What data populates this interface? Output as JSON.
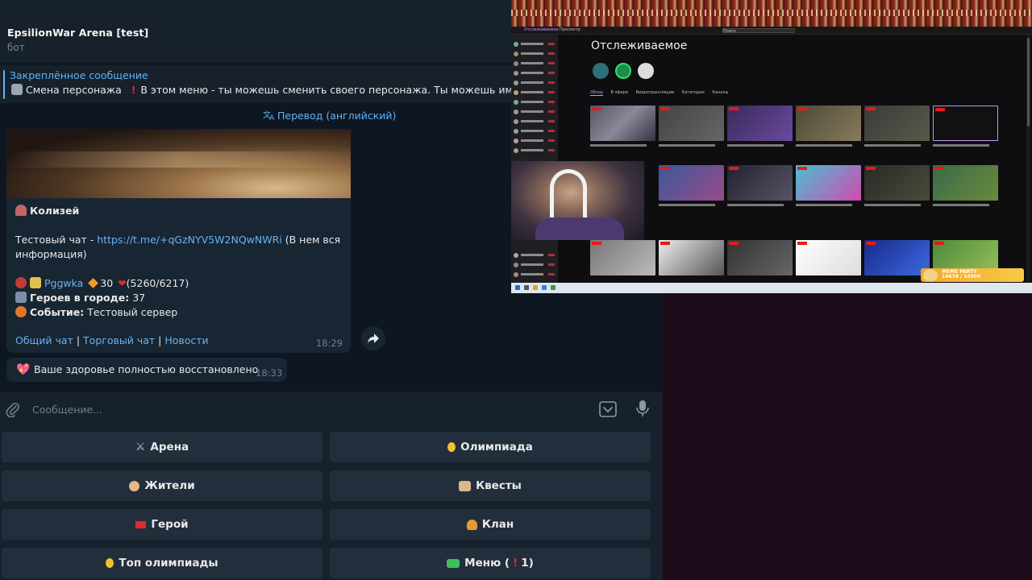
{
  "chat": {
    "title": "EpsilionWar Arena [test]",
    "subtitle": "бот"
  },
  "pinned": {
    "title": "Закреплённое сообщение",
    "text_a": "Смена персонажа",
    "text_b": "В этом меню - ты можешь сменить своего персонажа. Ты можешь иметь"
  },
  "translate_label": "Перевод (английский)",
  "message": {
    "location": "Колизей",
    "test_chat_label": "Тестовый чат - ",
    "test_chat_link": "https://t.me/+qGzNYV5W2NQwNWRi",
    "test_chat_suffix": " (В нем вся",
    "test_chat_suffix2": "информация)",
    "player_name": "Pggwka",
    "player_level": "30",
    "player_hp": "(5260/6217)",
    "heroes_label": "Героев в городе:",
    "heroes_count": "37",
    "event_label": "Событие:",
    "event_value": "Тестовый сервер",
    "link_general": "Общий чат",
    "link_trade": "Торговый чат",
    "link_news": "Новости",
    "separator": " | ",
    "time": "18:29"
  },
  "message2": {
    "text": "Ваше здоровье полностью восстановлено",
    "time": "18:33"
  },
  "compose": {
    "placeholder": "Сообщение..."
  },
  "keyboard": [
    {
      "label": "Арена",
      "icon": "crossed-swords-icon",
      "color": "#b8c4cc"
    },
    {
      "label": "Олимпиада",
      "icon": "medal-icon",
      "color": "#f2c230"
    },
    {
      "label": "Жители",
      "icon": "person-icon",
      "color": "#e8b48a"
    },
    {
      "label": "Квесты",
      "icon": "scroll-icon",
      "color": "#d9b98a"
    },
    {
      "label": "Герой",
      "icon": "flag-icon",
      "color": "#e0282e"
    },
    {
      "label": "Клан",
      "icon": "trophy-icon",
      "color": "#e39b2d"
    },
    {
      "label": "Топ олимпиады",
      "icon": "medal-icon",
      "color": "#f2c230"
    },
    {
      "label": "Меню (",
      "label_suffix": "1)",
      "icon": "menu-icon",
      "color": "#3fbf5a"
    }
  ],
  "stream": {
    "page_title": "Отслеживаемое",
    "tabs": [
      "Обзор",
      "В эфире",
      "Видеотрансляции",
      "Категории",
      "Каналы"
    ],
    "search_placeholder": "Поиск",
    "nav_following": "Отслеживаемое",
    "nav_browse": "Просмотр",
    "overlay_label": "MEME PARTY",
    "overlay_value": "14678 / 14900"
  }
}
